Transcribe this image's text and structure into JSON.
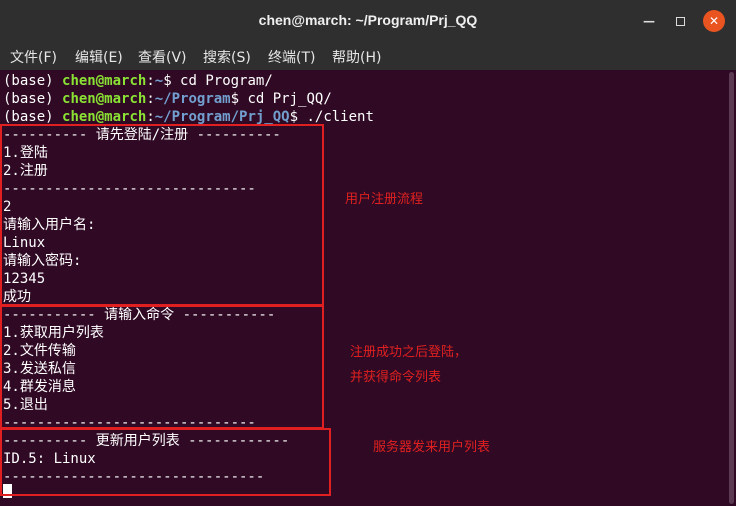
{
  "window": {
    "title": "chen@march: ~/Program/Prj_QQ",
    "minimize_icon": "minimize-icon",
    "maximize_icon": "maximize-icon",
    "close_icon": "close-icon",
    "accent": "#e95420"
  },
  "menu": [
    "文件(F)",
    "编辑(E)",
    "查看(V)",
    "搜索(S)",
    "终端(T)",
    "帮助(H)"
  ],
  "terminal": {
    "background": "#300a24",
    "prompt": {
      "env": "(base) ",
      "userhost": "chen@march",
      "colon": ":"
    },
    "commands": [
      {
        "path": "~",
        "cmd": "$ cd Program/"
      },
      {
        "path": "~/Program",
        "cmd": "$ cd Prj_QQ/"
      },
      {
        "path": "~/Program/Prj_QQ",
        "cmd": "$ ./client"
      }
    ],
    "output": [
      "---------- 请先登陆/注册 ----------",
      "1.登陆",
      "2.注册",
      "------------------------------",
      "2",
      "请输入用户名:",
      "Linux",
      "请输入密码:",
      "12345",
      "成功",
      "----------- 请输入命令 -----------",
      "1.获取用户列表",
      "2.文件传输",
      "3.发送私信",
      "4.群发消息",
      "5.退出",
      "------------------------------",
      "---------- 更新用户列表 ------------",
      "ID.5: Linux",
      "-------------------------------"
    ]
  },
  "annotations": {
    "register_flow": "用户注册流程",
    "after_register_line1": "注册成功之后登陆，",
    "after_register_line2": "并获得命令列表",
    "server_sends_list": "服务器发来用户列表",
    "color": "#e02020"
  }
}
